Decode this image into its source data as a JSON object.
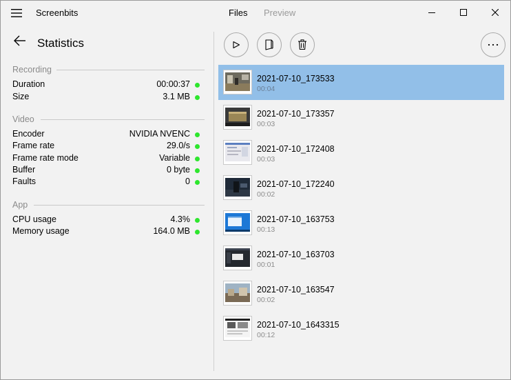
{
  "app": {
    "title": "Screenbits",
    "tabs": {
      "files": "Files",
      "preview": "Preview"
    }
  },
  "left_panel": {
    "title": "Statistics",
    "sections": {
      "recording": {
        "heading": "Recording",
        "rows": [
          {
            "label": "Duration",
            "value": "00:00:37",
            "status": "ok"
          },
          {
            "label": "Size",
            "value": "3.1  MB",
            "status": "ok"
          }
        ]
      },
      "video": {
        "heading": "Video",
        "rows": [
          {
            "label": "Encoder",
            "value": "NVIDIA NVENC",
            "status": "ok"
          },
          {
            "label": "Frame rate",
            "value": "29.0/s",
            "status": "ok"
          },
          {
            "label": "Frame rate mode",
            "value": "Variable",
            "status": "ok"
          },
          {
            "label": "Buffer",
            "value": "0 byte",
            "status": "ok"
          },
          {
            "label": "Faults",
            "value": "0",
            "status": "ok"
          }
        ]
      },
      "app": {
        "heading": "App",
        "rows": [
          {
            "label": "CPU usage",
            "value": "4.3%",
            "status": "ok"
          },
          {
            "label": "Memory usage",
            "value": "164.0  MB",
            "status": "ok"
          }
        ]
      }
    }
  },
  "toolbar": {
    "play_icon": "play-icon",
    "open_icon": "open-folder-icon",
    "delete_icon": "trash-icon",
    "more_icon": "more-ellipsis-icon"
  },
  "files": [
    {
      "name": "2021-07-10_173533",
      "duration": "00:04",
      "selected": true
    },
    {
      "name": "2021-07-10_173357",
      "duration": "00:03",
      "selected": false
    },
    {
      "name": "2021-07-10_172408",
      "duration": "00:03",
      "selected": false
    },
    {
      "name": "2021-07-10_172240",
      "duration": "00:02",
      "selected": false
    },
    {
      "name": "2021-07-10_163753",
      "duration": "00:13",
      "selected": false
    },
    {
      "name": "2021-07-10_163703",
      "duration": "00:01",
      "selected": false
    },
    {
      "name": "2021-07-10_163547",
      "duration": "00:02",
      "selected": false
    },
    {
      "name": "2021-07-10_1643315",
      "duration": "00:12",
      "selected": false
    }
  ],
  "colors": {
    "background": "#f2f2f2",
    "selected_row": "#92bfe8",
    "status_ok": "#2ee62e",
    "muted_text": "#8a8a8a"
  }
}
